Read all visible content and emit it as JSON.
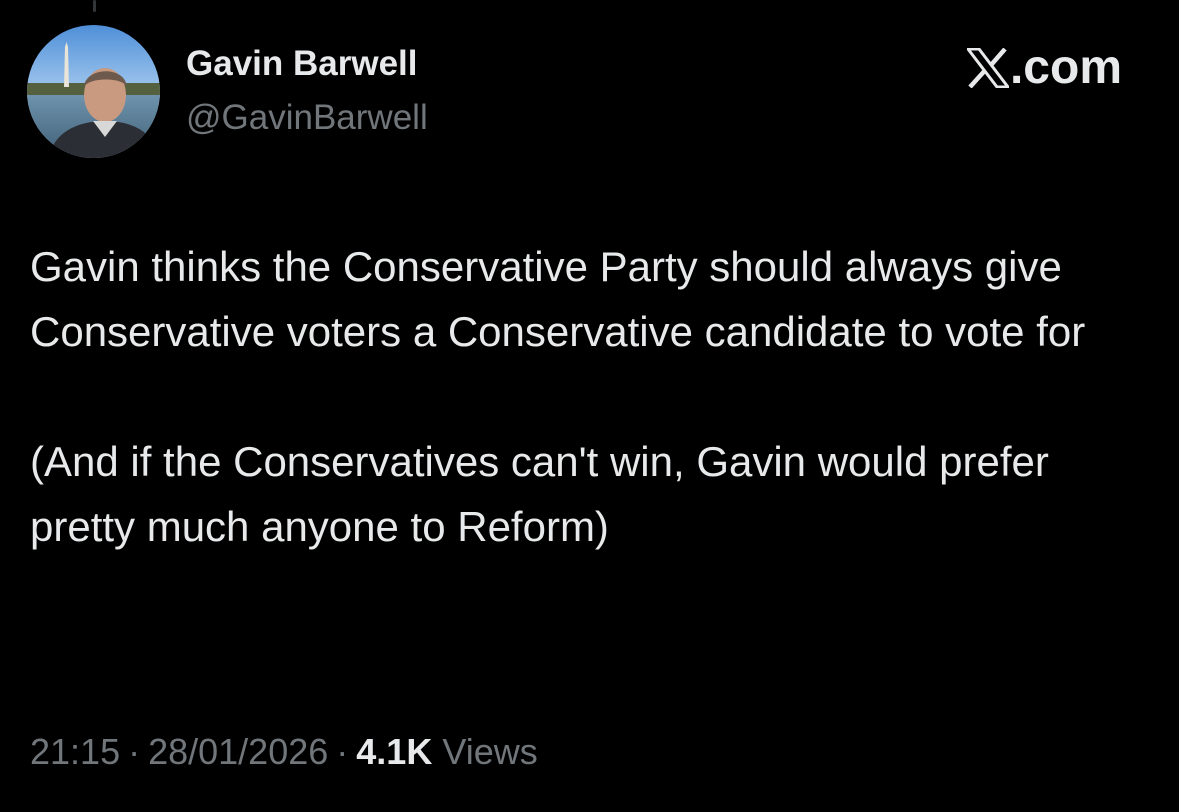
{
  "author": {
    "name": "Gavin Barwell",
    "handle": "@GavinBarwell",
    "avatar_icon": "profile-photo"
  },
  "brand": {
    "label": ".com",
    "logo_icon": "x-logo-icon"
  },
  "tweet": {
    "paragraphs": [
      "Gavin thinks the Conservative Party should always give Conservative voters a Conservative candidate to vote for",
      "(And if the Conservatives can't win, Gavin would prefer pretty much anyone to Reform)"
    ]
  },
  "meta": {
    "time": "21:15",
    "date": "28/01/2026",
    "separator": "·",
    "views_count": "4.1K",
    "views_label": "Views"
  },
  "colors": {
    "background": "#000000",
    "primary_text": "#e7e9ea",
    "secondary_text": "#71767b"
  }
}
